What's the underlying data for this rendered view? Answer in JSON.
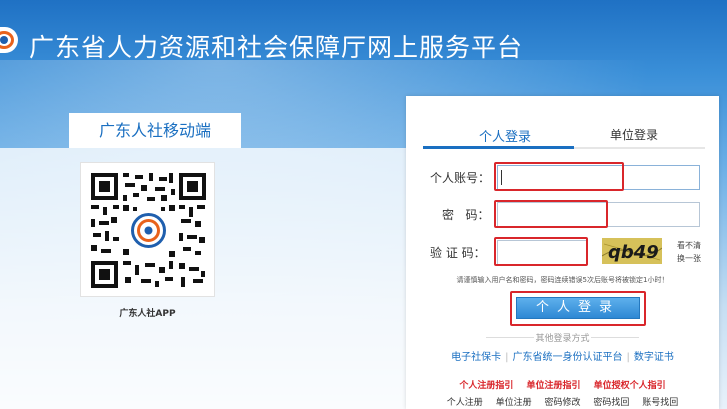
{
  "header": {
    "title": "广东省人力资源和社会保障厅网上服务平台"
  },
  "mobile": {
    "title": "广东人社移动端",
    "qr_caption": "广东人社APP"
  },
  "login": {
    "tabs": [
      {
        "label": "个人登录",
        "active": true
      },
      {
        "label": "单位登录",
        "active": false
      }
    ],
    "account_label": "个人账号：",
    "account_value": "",
    "password_label": "密   码：",
    "password_value": "",
    "captcha_label": "验 证 码：",
    "captcha_value": "",
    "captcha_text": "qb49",
    "captcha_refresh": [
      "看不清",
      "换一张"
    ],
    "tip": "请谨慎输入用户名和密码，密码连续错误5次后账号将被锁定1小时！",
    "submit_label": "个人登录",
    "other_login_label": "其他登录方式",
    "alt_links": [
      "电子社保卡",
      "广东省统一身份认证平台",
      "数字证书"
    ],
    "guides": [
      "个人注册指引",
      "单位注册指引",
      "单位授权个人指引"
    ],
    "bottom_links": [
      "个人注册",
      "单位注册",
      "密码修改",
      "密码找回",
      "账号找回"
    ]
  },
  "colors": {
    "accent": "#1a6fc1",
    "highlight_box": "#d9262b",
    "guide_text": "#d9262b"
  }
}
